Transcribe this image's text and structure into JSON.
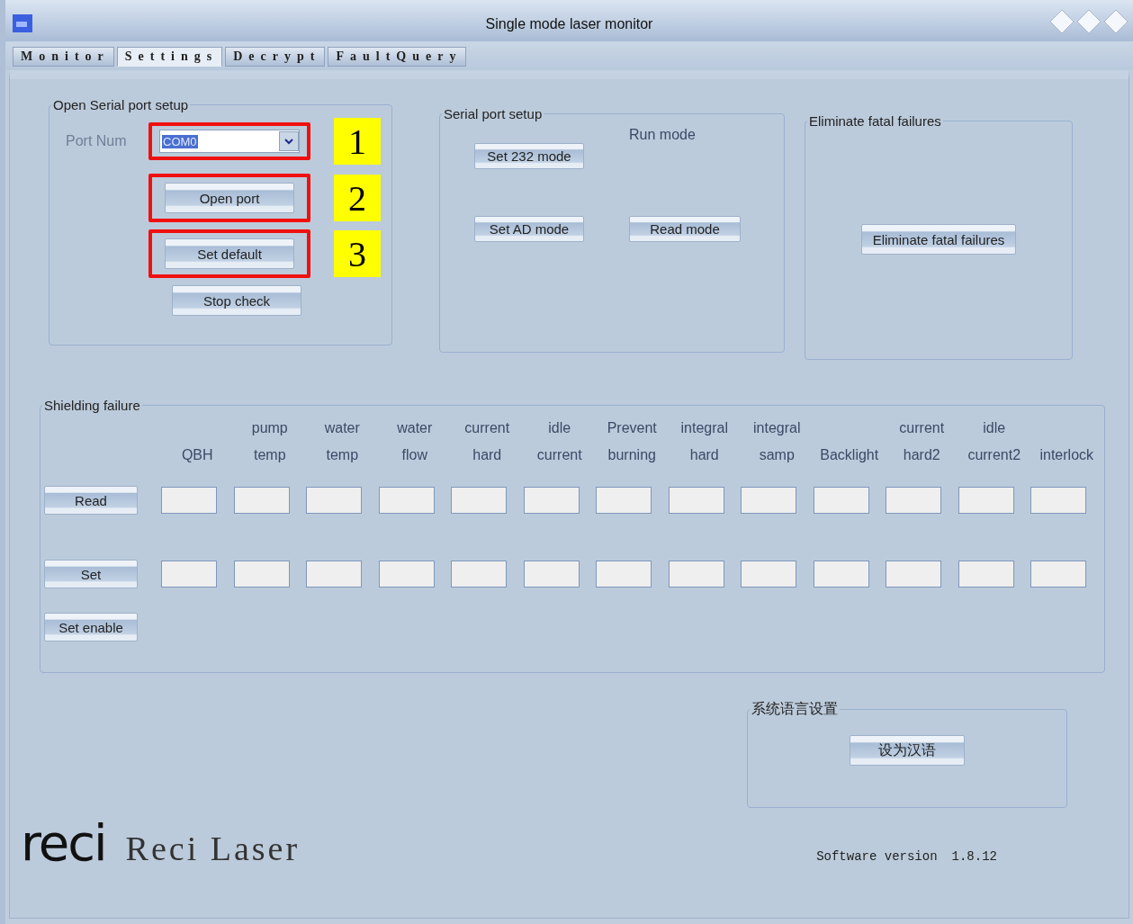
{
  "window": {
    "title": "Single mode laser monitor"
  },
  "tabs": [
    {
      "label": "Monitor",
      "selected": false
    },
    {
      "label": "Settings",
      "selected": true
    },
    {
      "label": "Decrypt",
      "selected": false
    },
    {
      "label": "FaultQuery",
      "selected": false
    }
  ],
  "open_serial_port_setup": {
    "title": "Open Serial port setup",
    "port_label": "Port Num",
    "port_value": "COM0",
    "callouts": [
      "1",
      "2",
      "3"
    ],
    "buttons": [
      "Open port",
      "Set default",
      "Stop check"
    ]
  },
  "serial_port_setup": {
    "title": "Serial port setup",
    "run_mode_label": "Run mode",
    "buttons": [
      "Set 232 mode",
      "Set AD mode",
      "Read mode"
    ]
  },
  "eliminate_fatal_failures": {
    "title": "Eliminate fatal failures",
    "button": "Eliminate fatal failures"
  },
  "shielding_failure": {
    "title": "Shielding failure",
    "columns": [
      {
        "bottom": "QBH"
      },
      {
        "top": "pump",
        "bottom": "temp"
      },
      {
        "top": "water",
        "bottom": "temp"
      },
      {
        "top": "water",
        "bottom": "flow"
      },
      {
        "top": "current",
        "bottom": "hard"
      },
      {
        "top": "idle",
        "bottom": "current"
      },
      {
        "top": "Prevent",
        "bottom": "burning"
      },
      {
        "top": "integral",
        "bottom": "hard"
      },
      {
        "top": "integral",
        "bottom": "samp"
      },
      {
        "bottom": "Backlight"
      },
      {
        "top": "current",
        "bottom": "hard2"
      },
      {
        "top": "idle",
        "bottom": "current2"
      },
      {
        "bottom": "interlock"
      }
    ],
    "buttons": [
      {
        "label": "Read",
        "kind": "field_row"
      },
      {
        "label": "Set",
        "kind": "field_row"
      },
      {
        "label": "Set enable",
        "kind": "plain"
      }
    ]
  },
  "language_setup": {
    "title": "系统语言设置",
    "button": "设为汉语"
  },
  "footer": {
    "logo": "reci",
    "brand": "Reci Laser",
    "version_label": "Software version",
    "version": "1.8.12"
  }
}
